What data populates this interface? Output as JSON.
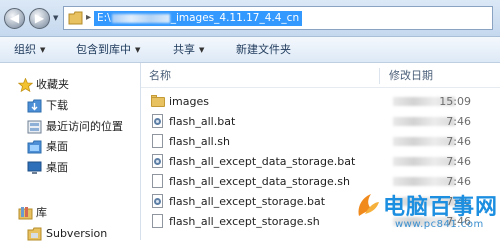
{
  "address_bar": {
    "path_prefix": "E:\\",
    "path_suffix": "_images_4.11.17_4.4_cn"
  },
  "toolbar": {
    "items": [
      {
        "label": "组织",
        "has_dropdown": true
      },
      {
        "label": "包含到库中",
        "has_dropdown": true
      },
      {
        "label": "共享",
        "has_dropdown": true
      },
      {
        "label": "新建文件夹",
        "has_dropdown": false
      }
    ]
  },
  "nav": {
    "favorites": "收藏夹",
    "items": [
      "下载",
      "最近访问的位置",
      "桌面",
      "桌面"
    ],
    "library": "库",
    "library_items": [
      "Subversion"
    ]
  },
  "file_list": {
    "columns": {
      "name": "名称",
      "date": "修改日期"
    },
    "rows": [
      {
        "name": "images",
        "type": "folder",
        "time": "15:09"
      },
      {
        "name": "flash_all.bat",
        "type": "bat",
        "time": "7:46"
      },
      {
        "name": "flash_all.sh",
        "type": "sh",
        "time": "7:46"
      },
      {
        "name": "flash_all_except_data_storage.bat",
        "type": "bat",
        "time": "7:46"
      },
      {
        "name": "flash_all_except_data_storage.sh",
        "type": "sh",
        "time": "7:46"
      },
      {
        "name": "flash_all_except_storage.bat",
        "type": "bat",
        "time": "7:46"
      },
      {
        "name": "flash_all_except_storage.sh",
        "type": "sh",
        "time": "7:46"
      }
    ]
  },
  "watermark": {
    "title": "电脑百事网",
    "url": "www.pc841.com"
  },
  "colors": {
    "selection": "#3399ff",
    "toolbar_text": "#1e395b",
    "watermark": "#1d8fe0"
  }
}
